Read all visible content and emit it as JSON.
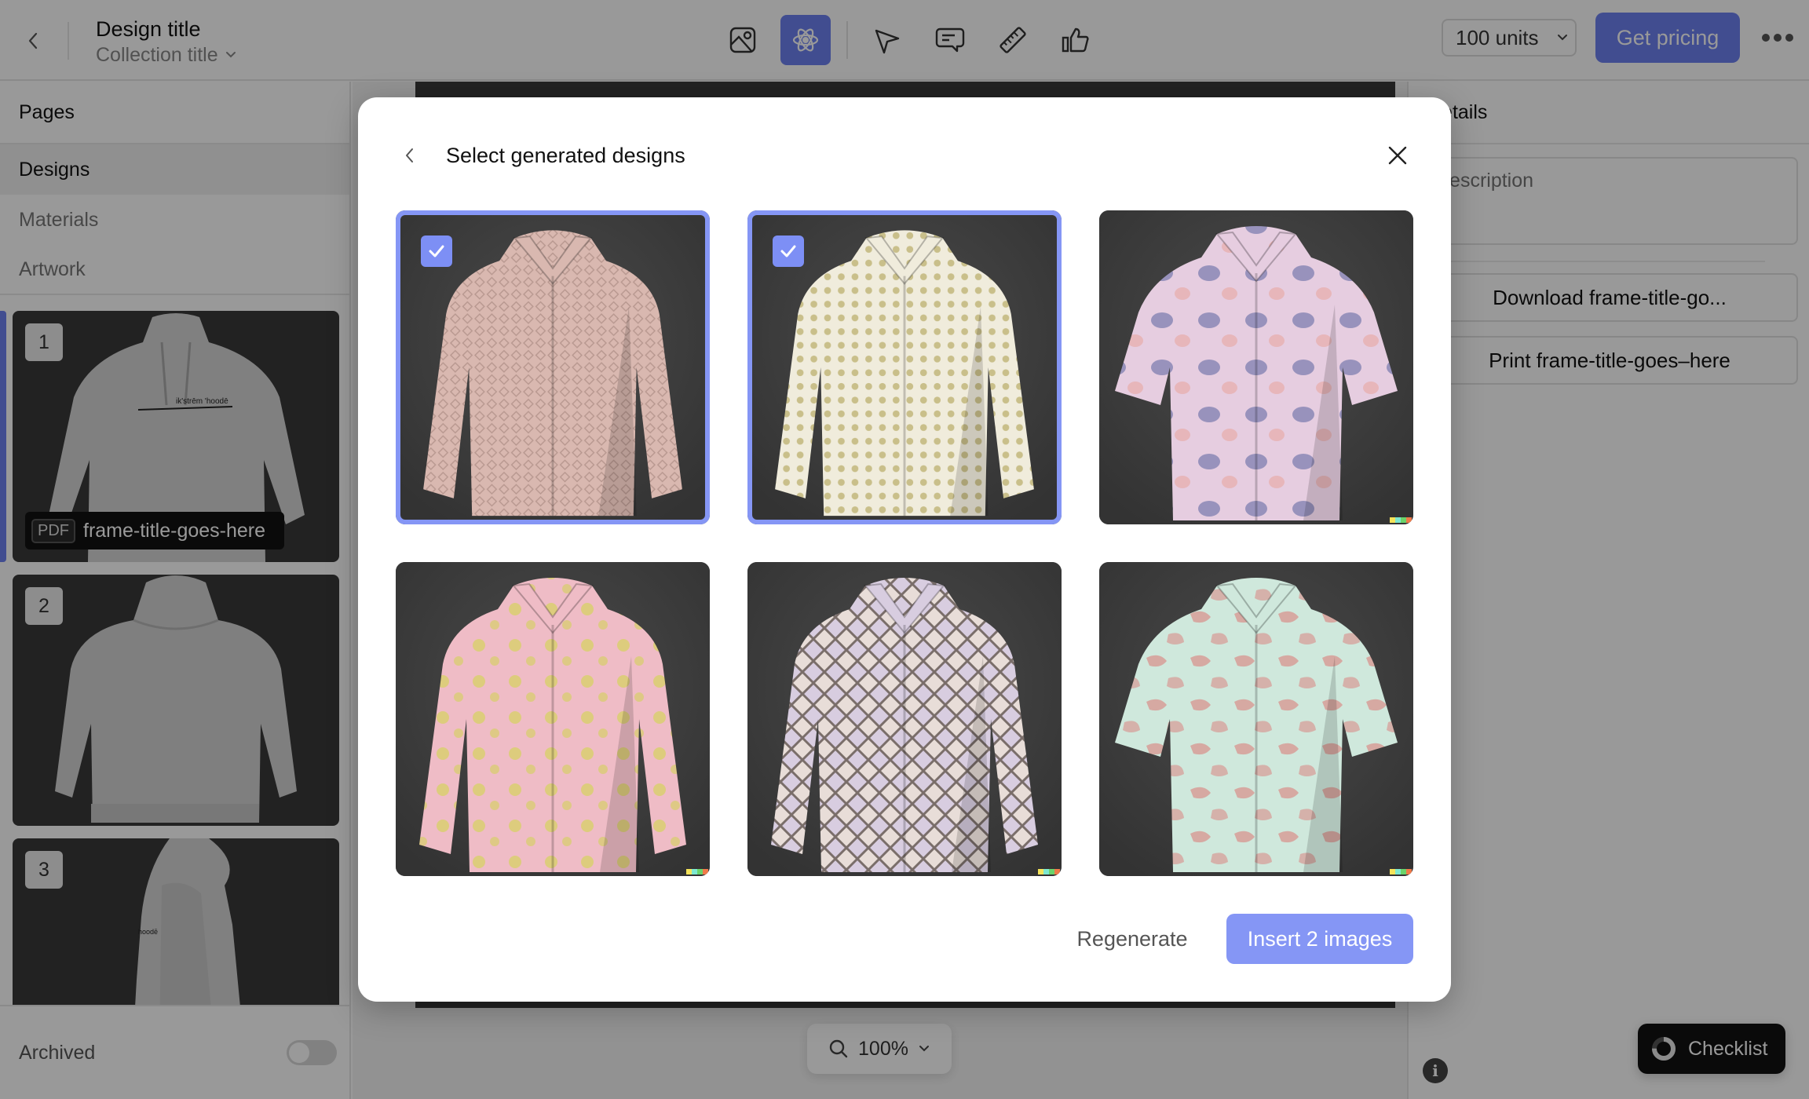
{
  "header": {
    "design_title": "Design title",
    "collection_title": "Collection title",
    "units_select": "100 units",
    "pricing_button": "Get pricing",
    "toolbar": [
      {
        "icon": "image-icon",
        "label": "Image",
        "active": false
      },
      {
        "icon": "ai-generate-icon",
        "label": "Generate",
        "active": true
      },
      {
        "icon": "pointer-icon",
        "label": "Select",
        "active": false
      },
      {
        "icon": "comment-icon",
        "label": "Comment",
        "active": false
      },
      {
        "icon": "ruler-icon",
        "label": "Measure",
        "active": false
      },
      {
        "icon": "thumbs-up-icon",
        "label": "Approve",
        "active": false
      }
    ],
    "accent_color": "#6d80f0"
  },
  "sidebar": {
    "heading": "Pages",
    "tabs": [
      {
        "label": "Designs",
        "active": true
      },
      {
        "label": "Materials",
        "active": false
      },
      {
        "label": "Artwork",
        "active": false
      }
    ],
    "pages": [
      {
        "number": "1",
        "view": "hoodie front",
        "selected": true,
        "file_type": "PDF",
        "frame_title": "frame-title-goes-here"
      },
      {
        "number": "2",
        "view": "hoodie back",
        "selected": false
      },
      {
        "number": "3",
        "view": "hoodie side",
        "selected": false
      }
    ],
    "archived_label": "Archived",
    "archived_on": false
  },
  "canvas": {
    "zoom_level": "100%"
  },
  "right_panel": {
    "heading": "Details",
    "description_placeholder": "Description",
    "download_button": "Download frame-title-go...",
    "print_button": "Print frame-title-goes–here",
    "checklist_label": "Checklist",
    "checklist_progress": 0.75
  },
  "modal": {
    "title": "Select generated designs",
    "designs": [
      {
        "name": "Pink geometric print long-sleeve shirt",
        "selected": true,
        "colors": [
          "#d9b8b0",
          "#b89890"
        ],
        "pattern": "diamond"
      },
      {
        "name": "Cream polka-dot shirt with pink placket",
        "selected": true,
        "colors": [
          "#f0ecdc",
          "#c9bf8a"
        ],
        "pattern": "dots"
      },
      {
        "name": "Lavender floral short-sleeve shirt",
        "selected": false,
        "colors": [
          "#e6cde0",
          "#7d7fb0"
        ],
        "pattern": "blotch"
      },
      {
        "name": "Pink yellow-floral shirt with blue hem",
        "selected": false,
        "colors": [
          "#efbcc6",
          "#d8cf6a"
        ],
        "pattern": "floral"
      },
      {
        "name": "Snakeskin print long-sleeve shirt",
        "selected": false,
        "colors": [
          "#d8cde0",
          "#7a6e6a"
        ],
        "pattern": "scale"
      },
      {
        "name": "Mint and coral camouflage short-sleeve shirt",
        "selected": false,
        "colors": [
          "#cfe8dc",
          "#d89a94"
        ],
        "pattern": "camo"
      }
    ],
    "regenerate_button": "Regenerate",
    "insert_button": "Insert 2 images",
    "button_color": "#8596f5"
  }
}
